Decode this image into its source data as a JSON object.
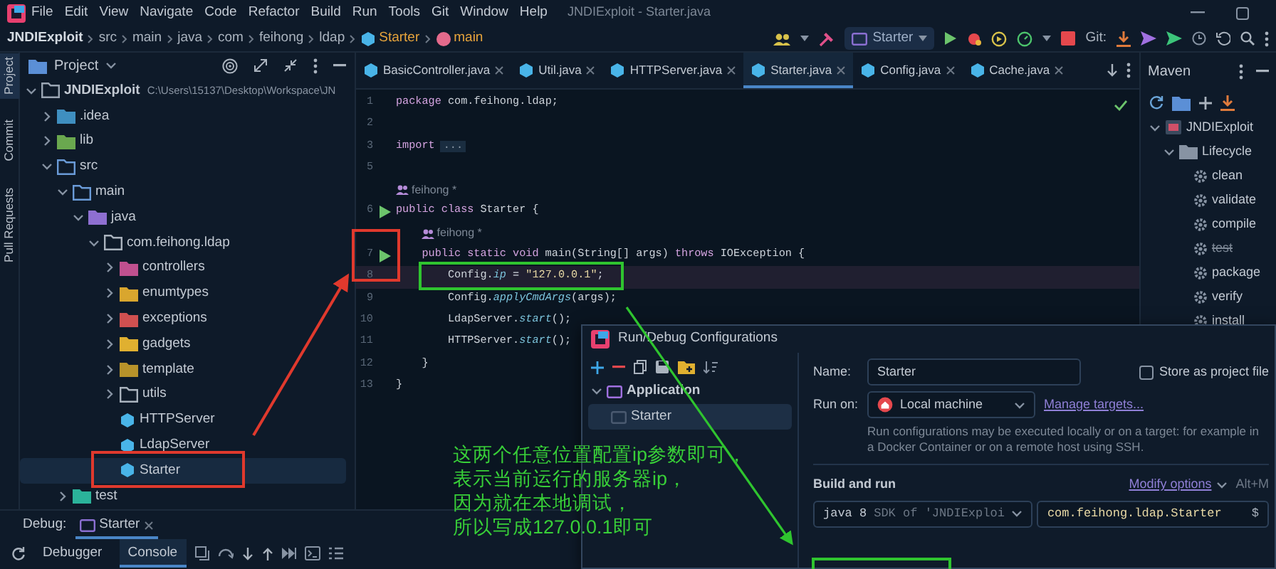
{
  "menu": [
    "File",
    "Edit",
    "View",
    "Navigate",
    "Code",
    "Refactor",
    "Build",
    "Run",
    "Tools",
    "Git",
    "Window",
    "Help"
  ],
  "window_title": "JNDIExploit - Starter.java",
  "breadcrumbs": [
    {
      "text": "JNDIExploit",
      "kind": "project"
    },
    {
      "text": "src",
      "kind": "folder"
    },
    {
      "text": "main",
      "kind": "folder"
    },
    {
      "text": "java",
      "kind": "folder"
    },
    {
      "text": "com",
      "kind": "folder"
    },
    {
      "text": "feihong",
      "kind": "folder"
    },
    {
      "text": "ldap",
      "kind": "folder"
    },
    {
      "text": "Starter",
      "kind": "class"
    },
    {
      "text": "main",
      "kind": "method"
    }
  ],
  "toolbar": {
    "run_configuration": "Starter",
    "git_label": "Git:"
  },
  "tool_stripe": [
    {
      "label": "Project",
      "selected": true
    },
    {
      "label": "Commit",
      "selected": false
    },
    {
      "label": "Pull Requests",
      "selected": false
    }
  ],
  "project_panel": {
    "title": "Project",
    "tree": [
      {
        "label": "JNDIExploit",
        "detail": "C:\\Users\\15137\\Desktop\\Workspace\\JN",
        "kind": "module",
        "expanded": true,
        "selected": false,
        "children": [
          {
            "label": ".idea",
            "kind": "folder",
            "color": "#3f8fc0",
            "expanded": false,
            "selected": false
          },
          {
            "label": "lib",
            "kind": "folder",
            "color": "#6aa84f",
            "expanded": false,
            "selected": false
          },
          {
            "label": "src",
            "kind": "source",
            "expanded": true,
            "selected": false,
            "children": [
              {
                "label": "main",
                "kind": "source",
                "expanded": true,
                "selected": false,
                "children": [
                  {
                    "label": "java",
                    "kind": "folder",
                    "color": "#8e6fd1",
                    "expanded": true,
                    "selected": false,
                    "children": [
                      {
                        "label": "com.feihong.ldap",
                        "kind": "package",
                        "expanded": true,
                        "selected": false,
                        "children": [
                          {
                            "label": "controllers",
                            "kind": "folder",
                            "color": "#c0508f",
                            "expanded": false,
                            "selected": false
                          },
                          {
                            "label": "enumtypes",
                            "kind": "folder",
                            "color": "#d9a62e",
                            "expanded": false,
                            "selected": false
                          },
                          {
                            "label": "exceptions",
                            "kind": "folder",
                            "color": "#d05050",
                            "expanded": false,
                            "selected": false
                          },
                          {
                            "label": "gadgets",
                            "kind": "folder",
                            "color": "#e0b030",
                            "expanded": false,
                            "selected": false
                          },
                          {
                            "label": "template",
                            "kind": "folder",
                            "color": "#b8932a",
                            "expanded": false,
                            "selected": false
                          },
                          {
                            "label": "utils",
                            "kind": "package",
                            "expanded": false,
                            "selected": false
                          },
                          {
                            "label": "HTTPServer",
                            "kind": "class",
                            "selected": false
                          },
                          {
                            "label": "LdapServer",
                            "kind": "class",
                            "selected": false
                          },
                          {
                            "label": "Starter",
                            "kind": "class",
                            "selected": true
                          }
                        ]
                      }
                    ]
                  }
                ]
              },
              {
                "label": "test",
                "kind": "folder",
                "color": "#2bb39a",
                "expanded": false,
                "selected": false
              }
            ]
          }
        ]
      }
    ]
  },
  "editor": {
    "tabs": [
      {
        "label": "BasicController.java",
        "selected": false
      },
      {
        "label": "Util.java",
        "selected": false
      },
      {
        "label": "HTTPServer.java",
        "selected": false
      },
      {
        "label": "Starter.java",
        "selected": true
      },
      {
        "label": "Config.java",
        "selected": false
      },
      {
        "label": "Cache.java",
        "selected": false
      }
    ],
    "lines": [
      {
        "kind": "code",
        "number": "1",
        "run": false,
        "current": false,
        "tokens": [
          {
            "kind": "keyword",
            "text": "package"
          },
          {
            "kind": "plain",
            "text": " com.feihong.ldap;"
          }
        ]
      },
      {
        "kind": "code",
        "number": "2",
        "run": false,
        "current": false
      },
      {
        "kind": "code",
        "number": "3",
        "run": false,
        "current": false,
        "tokens": [
          {
            "kind": "keyword",
            "text": "import"
          },
          {
            "kind": "fold",
            "text": "..."
          }
        ]
      },
      {
        "kind": "code",
        "number": "5",
        "run": false,
        "current": false
      },
      {
        "kind": "hint",
        "text": "feihong *"
      },
      {
        "kind": "code",
        "number": "6",
        "run": true,
        "current": false,
        "tokens": [
          {
            "kind": "keyword",
            "text": "public class"
          },
          {
            "kind": "plain",
            "text": " Starter {"
          }
        ],
        "children": [
          {
            "kind": "hint",
            "text": "feihong *"
          },
          {
            "kind": "code",
            "number": "7",
            "run": true,
            "current": false,
            "tokens": [
              {
                "kind": "keyword",
                "text": "public static void"
              },
              {
                "kind": "plain",
                "text": " main(String[] args) "
              },
              {
                "kind": "keyword",
                "text": "throws"
              },
              {
                "kind": "plain",
                "text": " IOException {"
              }
            ],
            "children": [
              {
                "kind": "code",
                "number": "8",
                "run": false,
                "current": true,
                "tokens": [
                  {
                    "kind": "plain",
                    "text": "Config."
                  },
                  {
                    "kind": "field",
                    "text": "ip"
                  },
                  {
                    "kind": "plain",
                    "text": " = "
                  },
                  {
                    "kind": "string",
                    "text": "\"127.0.0.1\""
                  },
                  {
                    "kind": "plain",
                    "text": ";"
                  }
                ]
              },
              {
                "kind": "code",
                "number": "9",
                "run": false,
                "current": false,
                "tokens": [
                  {
                    "kind": "plain",
                    "text": "Config."
                  },
                  {
                    "kind": "method",
                    "text": "applyCmdArgs"
                  },
                  {
                    "kind": "plain",
                    "text": "(args);"
                  }
                ]
              },
              {
                "kind": "code",
                "number": "10",
                "run": false,
                "current": false,
                "tokens": [
                  {
                    "kind": "plain",
                    "text": "LdapServer."
                  },
                  {
                    "kind": "method",
                    "text": "start"
                  },
                  {
                    "kind": "plain",
                    "text": "();"
                  }
                ]
              },
              {
                "kind": "code",
                "number": "11",
                "run": false,
                "current": false,
                "tokens": [
                  {
                    "kind": "plain",
                    "text": "HTTPServer."
                  },
                  {
                    "kind": "method",
                    "text": "start"
                  },
                  {
                    "kind": "plain",
                    "text": "();"
                  }
                ]
              }
            ]
          },
          {
            "kind": "code",
            "number": "12",
            "run": false,
            "current": false,
            "tokens": [
              {
                "kind": "plain",
                "text": "}"
              }
            ]
          }
        ]
      },
      {
        "kind": "code",
        "number": "13",
        "run": false,
        "current": false,
        "tokens": [
          {
            "kind": "plain",
            "text": "}"
          }
        ]
      }
    ]
  },
  "maven": {
    "title": "Maven",
    "tree": [
      {
        "label": "JNDIExploit",
        "kind": "module",
        "expanded": true,
        "children": [
          {
            "label": "Lifecycle",
            "kind": "group",
            "expanded": true,
            "children": [
              {
                "label": "clean",
                "kind": "goal",
                "skipped": false
              },
              {
                "label": "validate",
                "kind": "goal",
                "skipped": false
              },
              {
                "label": "compile",
                "kind": "goal",
                "skipped": false
              },
              {
                "label": "test",
                "kind": "goal",
                "skipped": true
              },
              {
                "label": "package",
                "kind": "goal",
                "skipped": false
              },
              {
                "label": "verify",
                "kind": "goal",
                "skipped": false
              },
              {
                "label": "install",
                "kind": "goal",
                "skipped": false
              }
            ]
          }
        ]
      }
    ]
  },
  "run_debug_dialog": {
    "title": "Run/Debug Configurations",
    "tree": [
      {
        "label": "Application",
        "expanded": true,
        "selected": false,
        "children": [
          {
            "label": "Starter",
            "selected": true
          }
        ]
      }
    ],
    "name_label": "Name:",
    "name_value": "Starter",
    "store_as_project_file": {
      "label": "Store as project file",
      "checked": false
    },
    "run_on_label": "Run on:",
    "run_on_value": "Local machine",
    "manage_targets": "Manage targets...",
    "help_text": "Run configurations may be executed locally or on a target: for example in a Docker Container or on a remote host using SSH.",
    "section_title": "Build and run",
    "modify_options": "Modify options",
    "shortcut": "Alt+M",
    "jdk": {
      "name": "java 8",
      "detail": "SDK of 'JNDIExploi"
    },
    "main_class": "com.feihong.ldap.Starter",
    "main_class_suffix": "$"
  },
  "debug_panel": {
    "label": "Debug:",
    "sessions": [
      {
        "label": "Starter",
        "selected": true
      }
    ],
    "tabs": [
      {
        "label": "Debugger",
        "selected": false
      },
      {
        "label": "Console",
        "selected": true
      }
    ]
  },
  "annotation": {
    "lines": [
      "这两个任意位置配置ip参数即可，",
      "表示当前运行的服务器ip，",
      "因为就在本地调试，",
      "所以写成127.0.0.1即可"
    ]
  }
}
